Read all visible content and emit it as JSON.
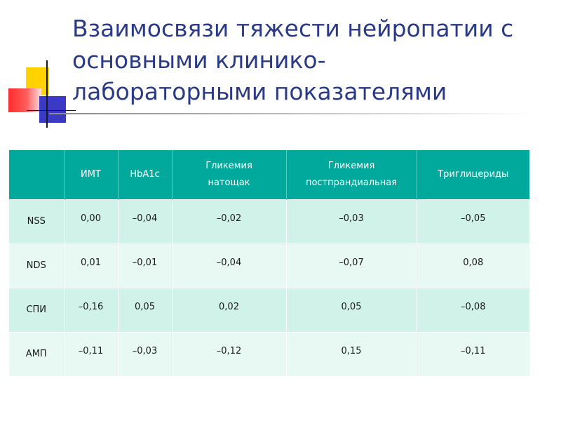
{
  "slide": {
    "title": "Взаимосвязи тяжести нейропатии с основными клинико-\nлабораторными показателями"
  },
  "table": {
    "corner": "",
    "headers": [
      [
        "ИМТ"
      ],
      [
        "HbA1c"
      ],
      [
        "Гликемия",
        "натощак"
      ],
      [
        "Гликемия",
        "постпрандиальная"
      ],
      [
        "Триглицериды"
      ]
    ],
    "rows": [
      {
        "label": "NSS",
        "values": [
          "0,00",
          "–0,04",
          "–0,02",
          "–0,03",
          "–0,05"
        ]
      },
      {
        "label": "NDS",
        "values": [
          "0,01",
          "–0,01",
          "–0,04",
          "–0,07",
          "0,08"
        ]
      },
      {
        "label": "СПИ",
        "values": [
          "–0,16",
          "0,05",
          "0,02",
          "0,05",
          "–0,08"
        ]
      },
      {
        "label": "АМП",
        "values": [
          "–0,11",
          "–0,03",
          "–0,12",
          "0,15",
          "–0,11"
        ]
      }
    ]
  },
  "colors": {
    "title": "#2a3a86",
    "header_bg": "#00a99b",
    "row_bg_odd": "#d1f2e8",
    "row_bg_even": "#e8f8f3",
    "logo_yellow": "#ffd200",
    "logo_red": "#ff2b2b",
    "logo_blue": "#3a3ac7"
  }
}
